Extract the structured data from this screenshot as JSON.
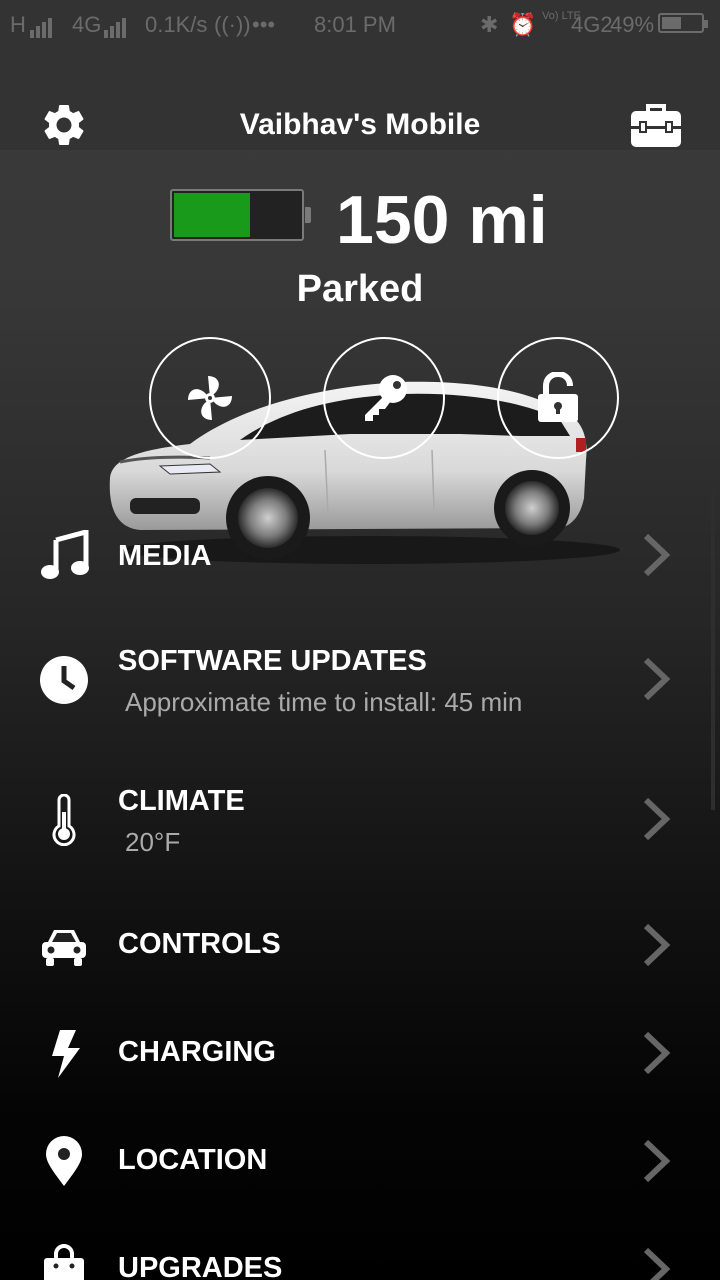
{
  "status_bar": {
    "left": "H",
    "network": "4G",
    "speed": "0.1K/s",
    "dots": "•••",
    "time": "8:01 PM",
    "volte": "Vo) LTE",
    "net2": "4G2",
    "battery_percent": "49%",
    "battery_level": 0.49
  },
  "header": {
    "title": "Vaibhav's Mobile",
    "settings_icon": "gear-icon",
    "toolbox_icon": "toolbox-icon"
  },
  "vehicle": {
    "range": "150 mi",
    "state": "Parked",
    "battery_level": 0.6,
    "battery_color": "#1a9a1a"
  },
  "quick_actions": [
    {
      "icon": "fan-icon",
      "name": "climate"
    },
    {
      "icon": "key-icon",
      "name": "key"
    },
    {
      "icon": "unlock-icon",
      "name": "lock"
    }
  ],
  "menu": [
    {
      "label": "MEDIA",
      "icon": "music-note-icon"
    },
    {
      "label": "SOFTWARE UPDATES",
      "sub": "Approximate time to install: 45 min",
      "icon": "clock-icon"
    },
    {
      "label": "CLIMATE",
      "sub": "20°F",
      "icon": "thermometer-icon"
    },
    {
      "label": "CONTROLS",
      "icon": "car-icon"
    },
    {
      "label": "CHARGING",
      "icon": "bolt-icon"
    },
    {
      "label": "LOCATION",
      "icon": "map-pin-icon"
    },
    {
      "label": "UPGRADES",
      "icon": "shopping-bag-icon"
    }
  ]
}
